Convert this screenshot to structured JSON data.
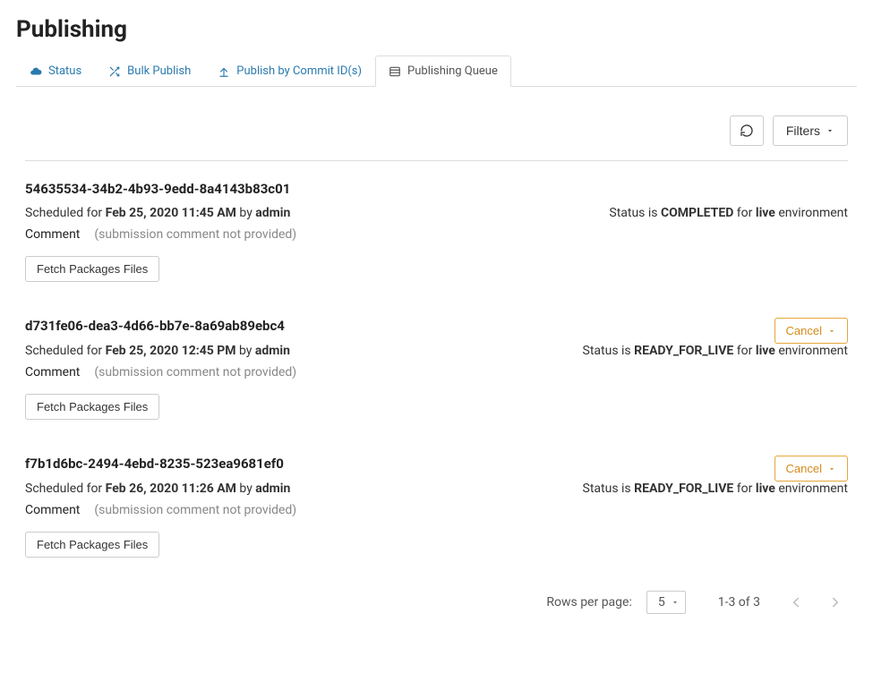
{
  "page_title": "Publishing",
  "tabs": [
    {
      "label": "Status"
    },
    {
      "label": "Bulk Publish"
    },
    {
      "label": "Publish by Commit ID(s)"
    },
    {
      "label": "Publishing Queue"
    }
  ],
  "toolbar": {
    "filters_label": "Filters"
  },
  "labels": {
    "scheduled_prefix": "Scheduled for ",
    "by": " by ",
    "status_prefix": "Status is ",
    "for": " for ",
    "env_suffix": " environment",
    "comment": "Comment",
    "fetch_btn": "Fetch Packages Files",
    "cancel": "Cancel",
    "rows_per_page": "Rows per page:"
  },
  "items": [
    {
      "id": "54635534-34b2-4b93-9edd-8a4143b83c01",
      "datetime": "Feb 25, 2020 11:45 AM",
      "user": "admin",
      "status": "COMPLETED",
      "env": "live",
      "comment": "(submission comment not provided)",
      "cancelable": false
    },
    {
      "id": "d731fe06-dea3-4d66-bb7e-8a69ab89ebc4",
      "datetime": "Feb 25, 2020 12:45 PM",
      "user": "admin",
      "status": "READY_FOR_LIVE",
      "env": "live",
      "comment": "(submission comment not provided)",
      "cancelable": true
    },
    {
      "id": "f7b1d6bc-2494-4ebd-8235-523ea9681ef0",
      "datetime": "Feb 26, 2020 11:26 AM",
      "user": "admin",
      "status": "READY_FOR_LIVE",
      "env": "live",
      "comment": "(submission comment not provided)",
      "cancelable": true
    }
  ],
  "pagination": {
    "page_size": "5",
    "range": "1-3 of 3"
  }
}
